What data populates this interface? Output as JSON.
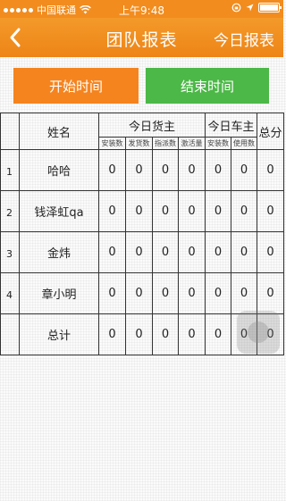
{
  "status_bar": {
    "carrier": "中国联通",
    "time": "上午9:48",
    "colors": {
      "background": "#f28c1e"
    }
  },
  "navbar": {
    "title": "团队报表",
    "right_button": "今日报表",
    "back_icon": "chevron-left-icon",
    "colors": {
      "background": "#ee8417"
    }
  },
  "buttons": {
    "start_time": "开始时间",
    "end_time": "结束时间",
    "colors": {
      "start": "#f5841f",
      "end": "#4cb847"
    }
  },
  "table": {
    "headers": {
      "name": "姓名",
      "today_shipper": "今日货主",
      "today_driver": "今日车主",
      "total_score_truncated": "总分"
    },
    "subheaders": [
      "安装数",
      "发货数",
      "指派数",
      "激活量",
      "安装数",
      "使用数"
    ],
    "rows": [
      {
        "index": "1",
        "name": "哈哈",
        "values": [
          "0",
          "0",
          "0",
          "0",
          "0",
          "0",
          "0"
        ]
      },
      {
        "index": "2",
        "name": "钱泽虹qa",
        "values": [
          "0",
          "0",
          "0",
          "0",
          "0",
          "0",
          "0"
        ]
      },
      {
        "index": "3",
        "name": "金炜",
        "values": [
          "0",
          "0",
          "0",
          "0",
          "0",
          "0",
          "0"
        ]
      },
      {
        "index": "4",
        "name": "章小明",
        "values": [
          "0",
          "0",
          "0",
          "0",
          "0",
          "0",
          "0"
        ]
      },
      {
        "index": "",
        "name": "总计",
        "values": [
          "0",
          "0",
          "0",
          "0",
          "0",
          "0",
          "0"
        ]
      }
    ]
  }
}
